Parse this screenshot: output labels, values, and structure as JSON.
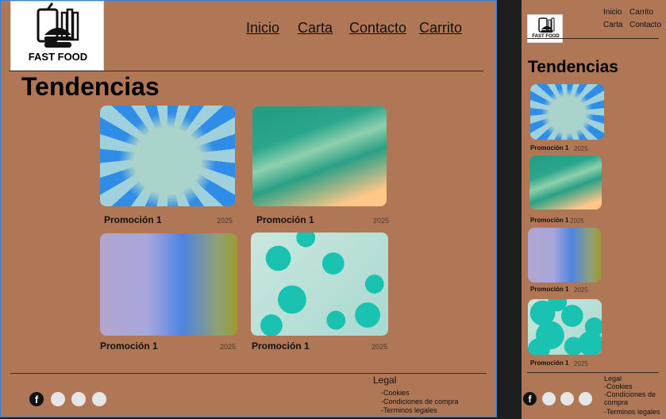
{
  "brand": {
    "logo_text": "FAST FOOD"
  },
  "nav": {
    "inicio": "Inicio",
    "carta": "Carta",
    "contacto": "Contacto",
    "carrito": "Carrito"
  },
  "section_title": "Tendencias",
  "cards": [
    {
      "label": "Promoción 1",
      "year": "2025"
    },
    {
      "label": "Promoción 1",
      "year": "2025"
    },
    {
      "label": "Promoción 1",
      "year": "2025"
    },
    {
      "label": "Promoción 1",
      "year": "2025"
    }
  ],
  "mobile_cards": [
    {
      "label": "Promoción 1",
      "year": "2025"
    },
    {
      "label": "Promoción 1",
      "year": "2025"
    },
    {
      "label": "Promoción 1",
      "year": "2025"
    },
    {
      "label": "Promoción 1",
      "year": "2025"
    }
  ],
  "footer": {
    "legal_title": "Legal",
    "legal_items": [
      "-Cookies",
      "-Condiciones de compra",
      "-Terminos  legales"
    ],
    "social_icons": [
      "facebook-icon",
      "social-icon-2",
      "social-icon-3",
      "social-icon-4"
    ]
  },
  "colors": {
    "background": "#b07756",
    "frame_border": "#3a7fd5",
    "canvas": "#1e1e1e"
  }
}
